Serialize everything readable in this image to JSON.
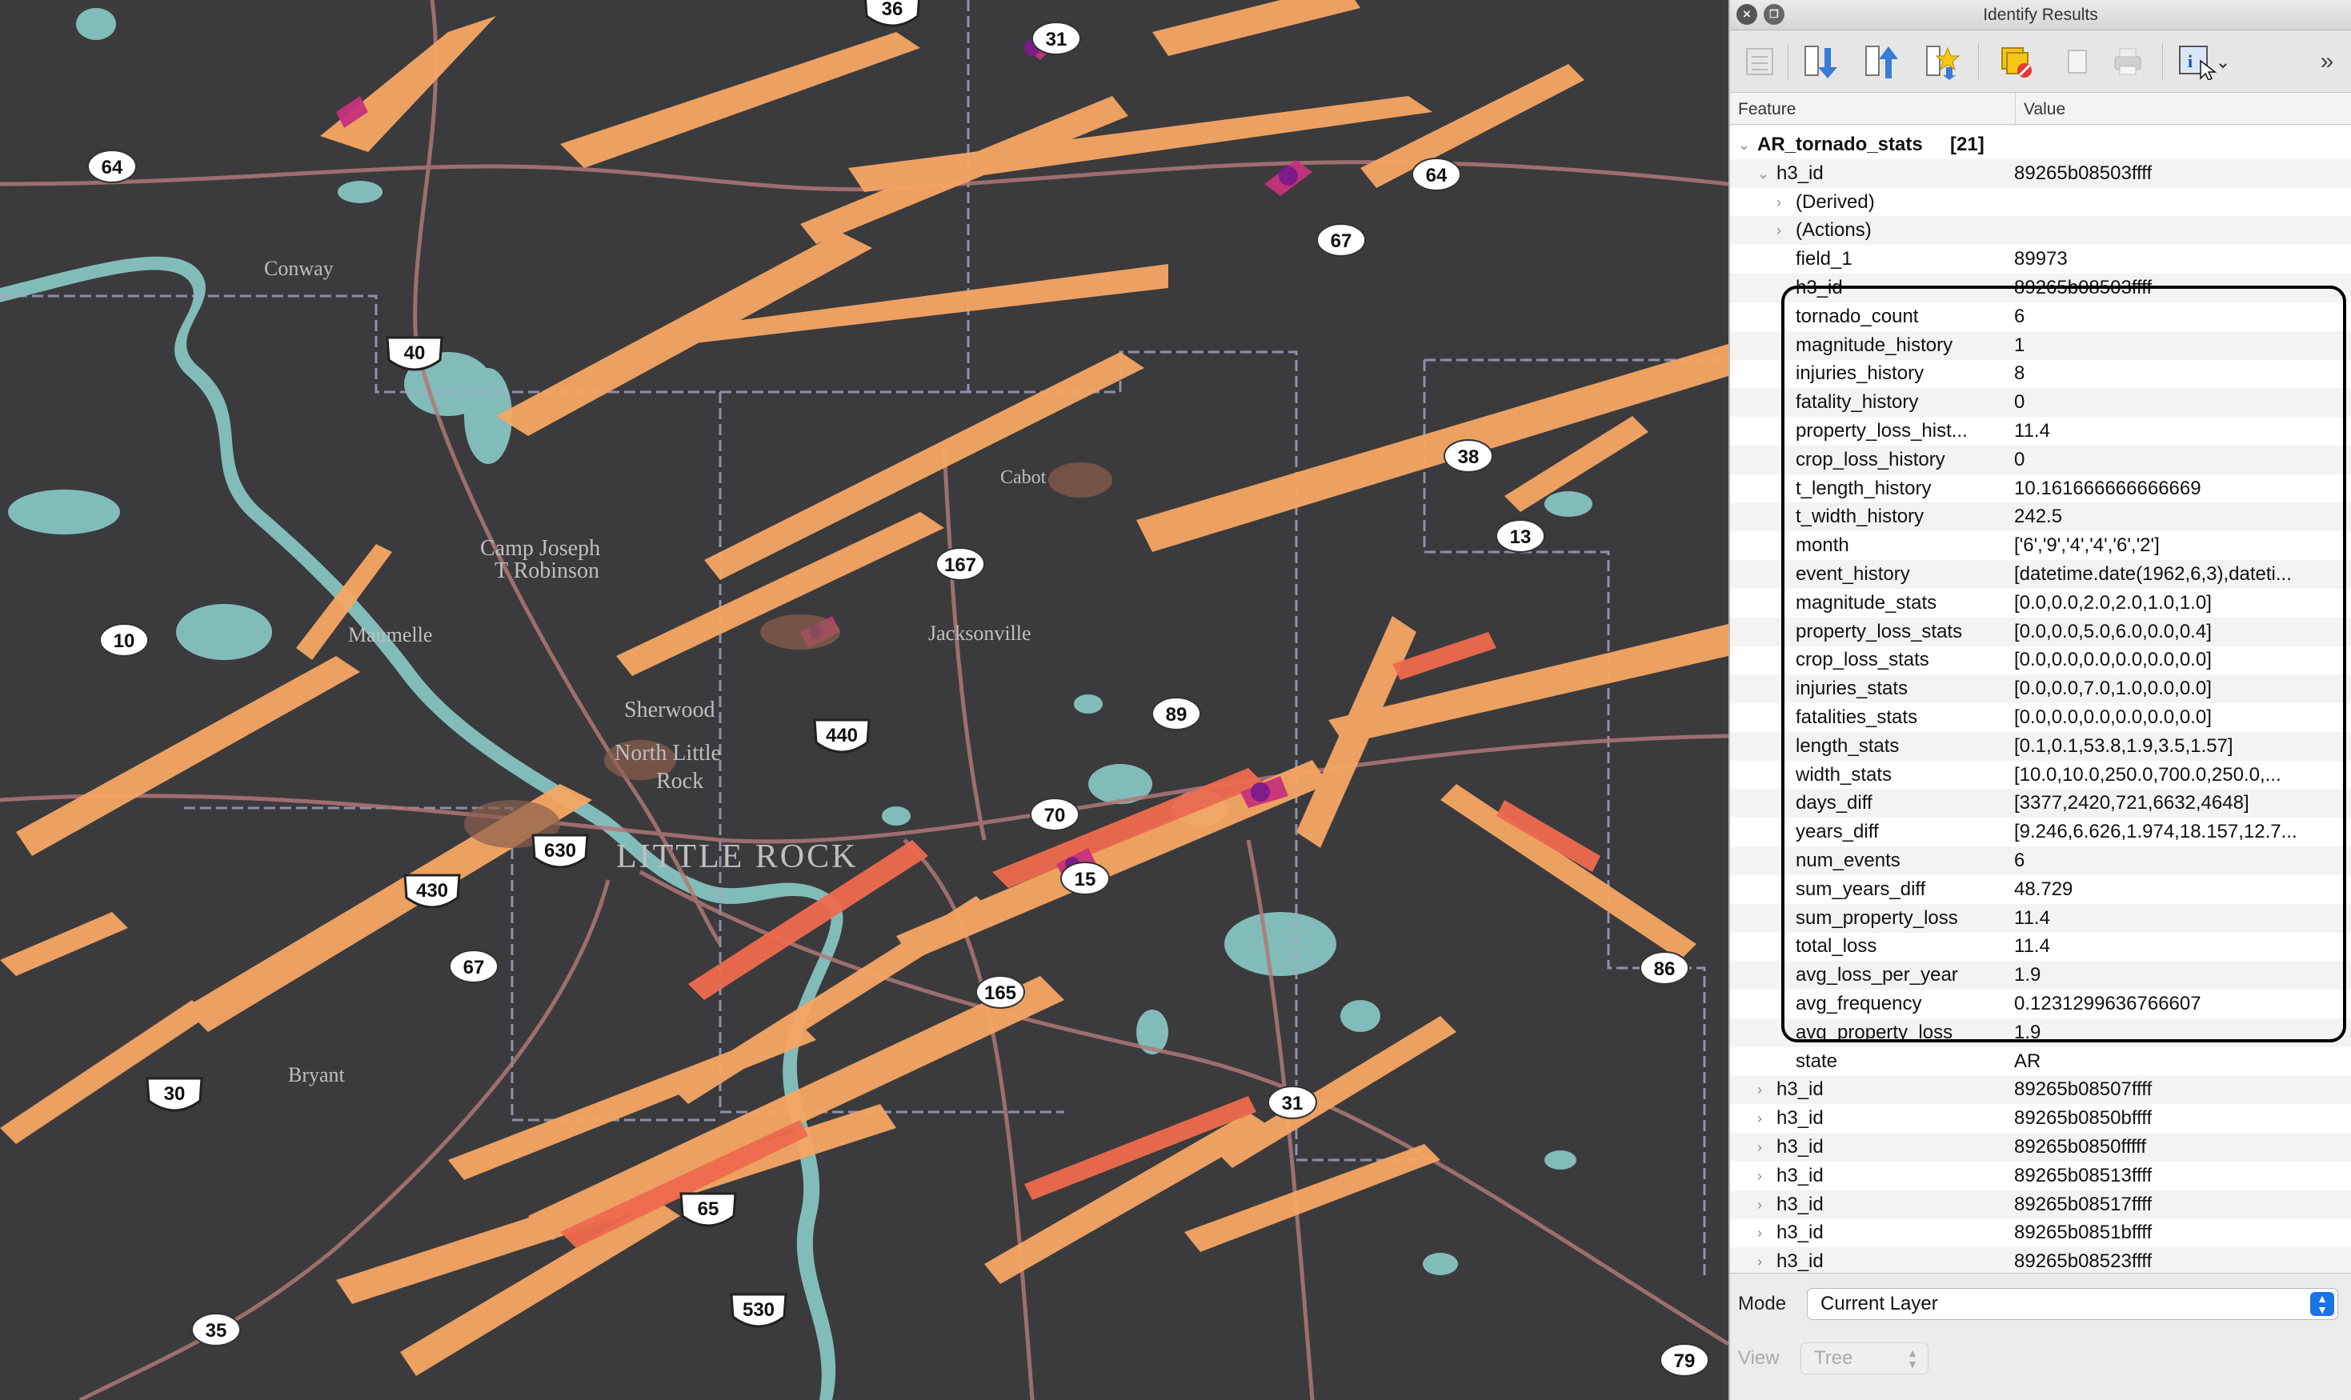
{
  "map": {
    "places": [
      "Conway",
      "Cabot",
      "Camp Joseph",
      "T Robinson",
      "Maumelle",
      "Sherwood",
      "North Little",
      "Rock",
      "LITTLE ROCK",
      "Jacksonville",
      "Bryant"
    ],
    "shields": [
      "36",
      "31",
      "64",
      "64",
      "67",
      "40",
      "38",
      "13",
      "167",
      "10",
      "440",
      "89",
      "70",
      "15",
      "630",
      "430",
      "67",
      "165",
      "86",
      "30",
      "31",
      "65",
      "530",
      "35",
      "79"
    ]
  },
  "panel": {
    "title": "Identify Results",
    "toolbar": {
      "tools": [
        "expand-tree-icon",
        "collapse-tree-icon",
        "expand-new-icon",
        "clear-results-icon",
        "copy-icon",
        "print-icon",
        "identify-select-icon",
        "more-icon"
      ]
    },
    "columns": {
      "feature": "Feature",
      "value": "Value"
    },
    "layer": {
      "name": "AR_tornado_stats",
      "count": "[21]"
    },
    "first_feature": {
      "key": "h3_id",
      "value": "89265b08503ffff"
    },
    "derived": "(Derived)",
    "actions": "(Actions)",
    "attributes": [
      {
        "k": "field_1",
        "v": "89973"
      },
      {
        "k": "h3_id",
        "v": "89265b08503ffff"
      },
      {
        "k": "tornado_count",
        "v": "6"
      },
      {
        "k": "magnitude_history",
        "v": "1"
      },
      {
        "k": "injuries_history",
        "v": "8"
      },
      {
        "k": "fatality_history",
        "v": "0"
      },
      {
        "k": "property_loss_hist...",
        "v": "11.4"
      },
      {
        "k": "crop_loss_history",
        "v": "0"
      },
      {
        "k": "t_length_history",
        "v": "10.161666666666669"
      },
      {
        "k": "t_width_history",
        "v": "242.5"
      },
      {
        "k": "month",
        "v": "['6','9','4','4','6','2']"
      },
      {
        "k": "event_history",
        "v": "[datetime.date(1962,6,3),dateti..."
      },
      {
        "k": "magnitude_stats",
        "v": "[0.0,0.0,2.0,2.0,1.0,1.0]"
      },
      {
        "k": "property_loss_stats",
        "v": "[0.0,0.0,5.0,6.0,0.0,0.4]"
      },
      {
        "k": "crop_loss_stats",
        "v": "[0.0,0.0,0.0,0.0,0.0,0.0]"
      },
      {
        "k": "injuries_stats",
        "v": "[0.0,0.0,7.0,1.0,0.0,0.0]"
      },
      {
        "k": "fatalities_stats",
        "v": "[0.0,0.0,0.0,0.0,0.0,0.0]"
      },
      {
        "k": "length_stats",
        "v": "[0.1,0.1,53.8,1.9,3.5,1.57]"
      },
      {
        "k": "width_stats",
        "v": "[10.0,10.0,250.0,700.0,250.0,..."
      },
      {
        "k": "days_diff",
        "v": "[3377,2420,721,6632,4648]"
      },
      {
        "k": "years_diff",
        "v": "[9.246,6.626,1.974,18.157,12.7..."
      },
      {
        "k": "num_events",
        "v": "6"
      },
      {
        "k": "sum_years_diff",
        "v": "48.729"
      },
      {
        "k": "sum_property_loss",
        "v": "11.4"
      },
      {
        "k": "total_loss",
        "v": "11.4"
      },
      {
        "k": "avg_loss_per_year",
        "v": "1.9"
      },
      {
        "k": "avg_frequency",
        "v": "0.1231299636766607"
      },
      {
        "k": "avg_property_loss",
        "v": "1.9"
      },
      {
        "k": "state",
        "v": "AR"
      }
    ],
    "other_features": [
      {
        "k": "h3_id",
        "v": "89265b08507ffff"
      },
      {
        "k": "h3_id",
        "v": "89265b0850bffff"
      },
      {
        "k": "h3_id",
        "v": "89265b0850fffff"
      },
      {
        "k": "h3_id",
        "v": "89265b08513ffff"
      },
      {
        "k": "h3_id",
        "v": "89265b08517ffff"
      },
      {
        "k": "h3_id",
        "v": "89265b0851bffff"
      },
      {
        "k": "h3_id",
        "v": "89265b08523ffff"
      }
    ],
    "mode": {
      "label": "Mode",
      "value": "Current Layer"
    },
    "view": {
      "label": "View",
      "value": "Tree"
    }
  }
}
